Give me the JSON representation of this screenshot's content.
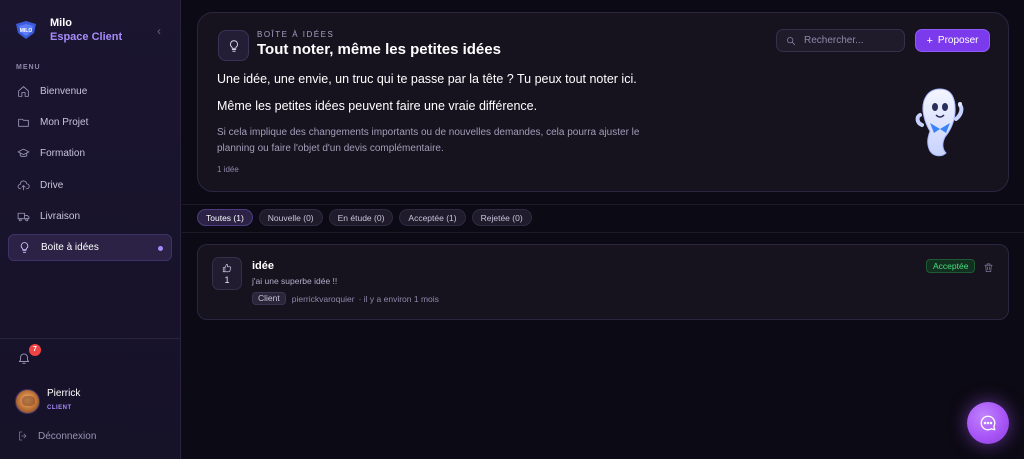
{
  "sidebar": {
    "brand_name": "Milo",
    "brand_subtitle": "Espace Client",
    "menu_label": "MENU",
    "items": [
      {
        "label": "Bienvenue",
        "icon": "home-icon"
      },
      {
        "label": "Mon Projet",
        "icon": "folder-icon"
      },
      {
        "label": "Formation",
        "icon": "graduation-cap-icon"
      },
      {
        "label": "Drive",
        "icon": "cloud-upload-icon"
      },
      {
        "label": "Livraison",
        "icon": "truck-icon"
      },
      {
        "label": "Boite à idées",
        "icon": "lightbulb-icon",
        "active": true
      }
    ],
    "notification_count": "7",
    "user": {
      "name": "Pierrick",
      "role": "CLIENT"
    },
    "logout_label": "Déconnexion"
  },
  "hero": {
    "eyebrow": "BOÎTE À IDÉES",
    "title": "Tout noter, même les petites idées",
    "search_placeholder": "Rechercher...",
    "propose_label": "Proposer",
    "paragraph1": "Une idée, une envie, un truc qui te passe par la tête ? Tu peux tout noter ici.",
    "paragraph2": "Même les petites idées peuvent faire une vraie différence.",
    "paragraph3": "Si cela implique des changements importants ou de nouvelles demandes, cela pourra ajuster le planning ou faire l'objet d'un devis complémentaire.",
    "count": "1 idée"
  },
  "filters": [
    {
      "label": "Toutes (1)",
      "active": true
    },
    {
      "label": "Nouvelle (0)"
    },
    {
      "label": "En étude (0)"
    },
    {
      "label": "Acceptée (1)"
    },
    {
      "label": "Rejetée (0)"
    }
  ],
  "ideas": [
    {
      "votes": "1",
      "title": "idée",
      "description": "j'ai une superbe idée !!",
      "author_badge": "Client",
      "author": "pierrickvaroquier",
      "time": "· il y a environ 1 mois",
      "status": "Acceptée"
    }
  ],
  "colors": {
    "accent": "#7c3aed",
    "accent_light": "#a78bfa",
    "status_accepted": "#4ade80",
    "badge": "#ef4444"
  }
}
